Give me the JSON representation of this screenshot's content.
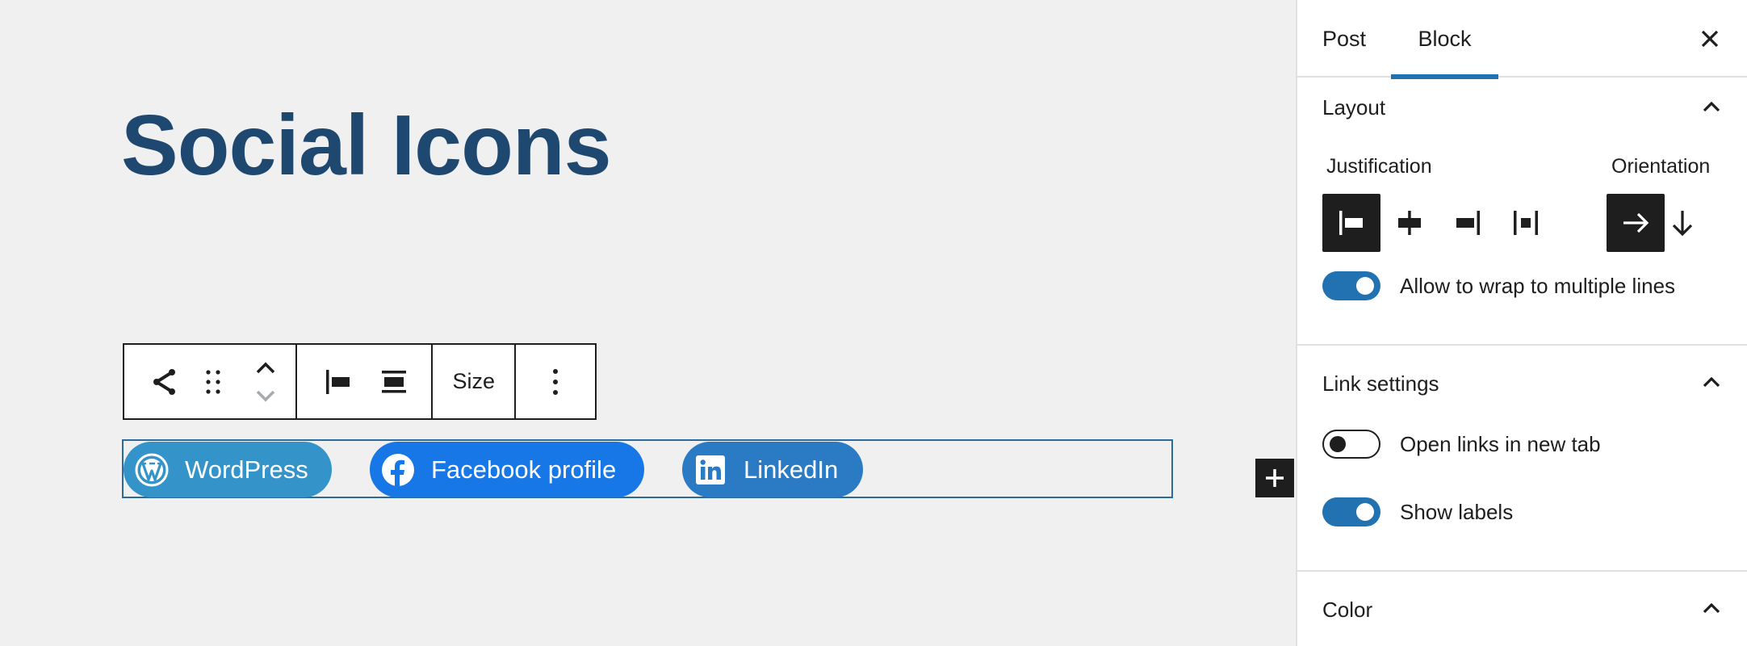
{
  "canvas": {
    "title": "Social Icons",
    "toolbar": {
      "block_icon": "share-icon",
      "drag_icon": "drag-handle-icon",
      "move_icon": "move-up-down-icon",
      "justify_icon": "justify-left-icon",
      "align_icon": "align-wide-icon",
      "size_label": "Size",
      "options_icon": "more-vertical-icon"
    },
    "social_links": [
      {
        "label": "WordPress",
        "icon": "wordpress-icon",
        "color": "#3494ca"
      },
      {
        "label": "Facebook profile",
        "icon": "facebook-icon",
        "color": "#1877e6"
      },
      {
        "label": "LinkedIn",
        "icon": "linkedin-icon",
        "color": "#2b7ac4"
      }
    ],
    "add_icon": "plus-icon"
  },
  "sidebar": {
    "tabs": [
      {
        "label": "Post",
        "active": false
      },
      {
        "label": "Block",
        "active": true
      }
    ],
    "close_icon": "close-icon",
    "accent": "#2271b1",
    "panels": {
      "layout": {
        "title": "Layout",
        "justification_label": "Justification",
        "justification_options": [
          "justify-left",
          "justify-center",
          "justify-right",
          "justify-space-between"
        ],
        "justification_selected": "justify-left",
        "orientation_label": "Orientation",
        "orientation_options": [
          "horizontal",
          "vertical"
        ],
        "orientation_selected": "horizontal",
        "wrap_label": "Allow to wrap to multiple lines",
        "wrap_on": true
      },
      "link_settings": {
        "title": "Link settings",
        "new_tab_label": "Open links in new tab",
        "new_tab_on": false,
        "show_labels_label": "Show labels",
        "show_labels_on": true
      },
      "color": {
        "title": "Color"
      }
    }
  }
}
